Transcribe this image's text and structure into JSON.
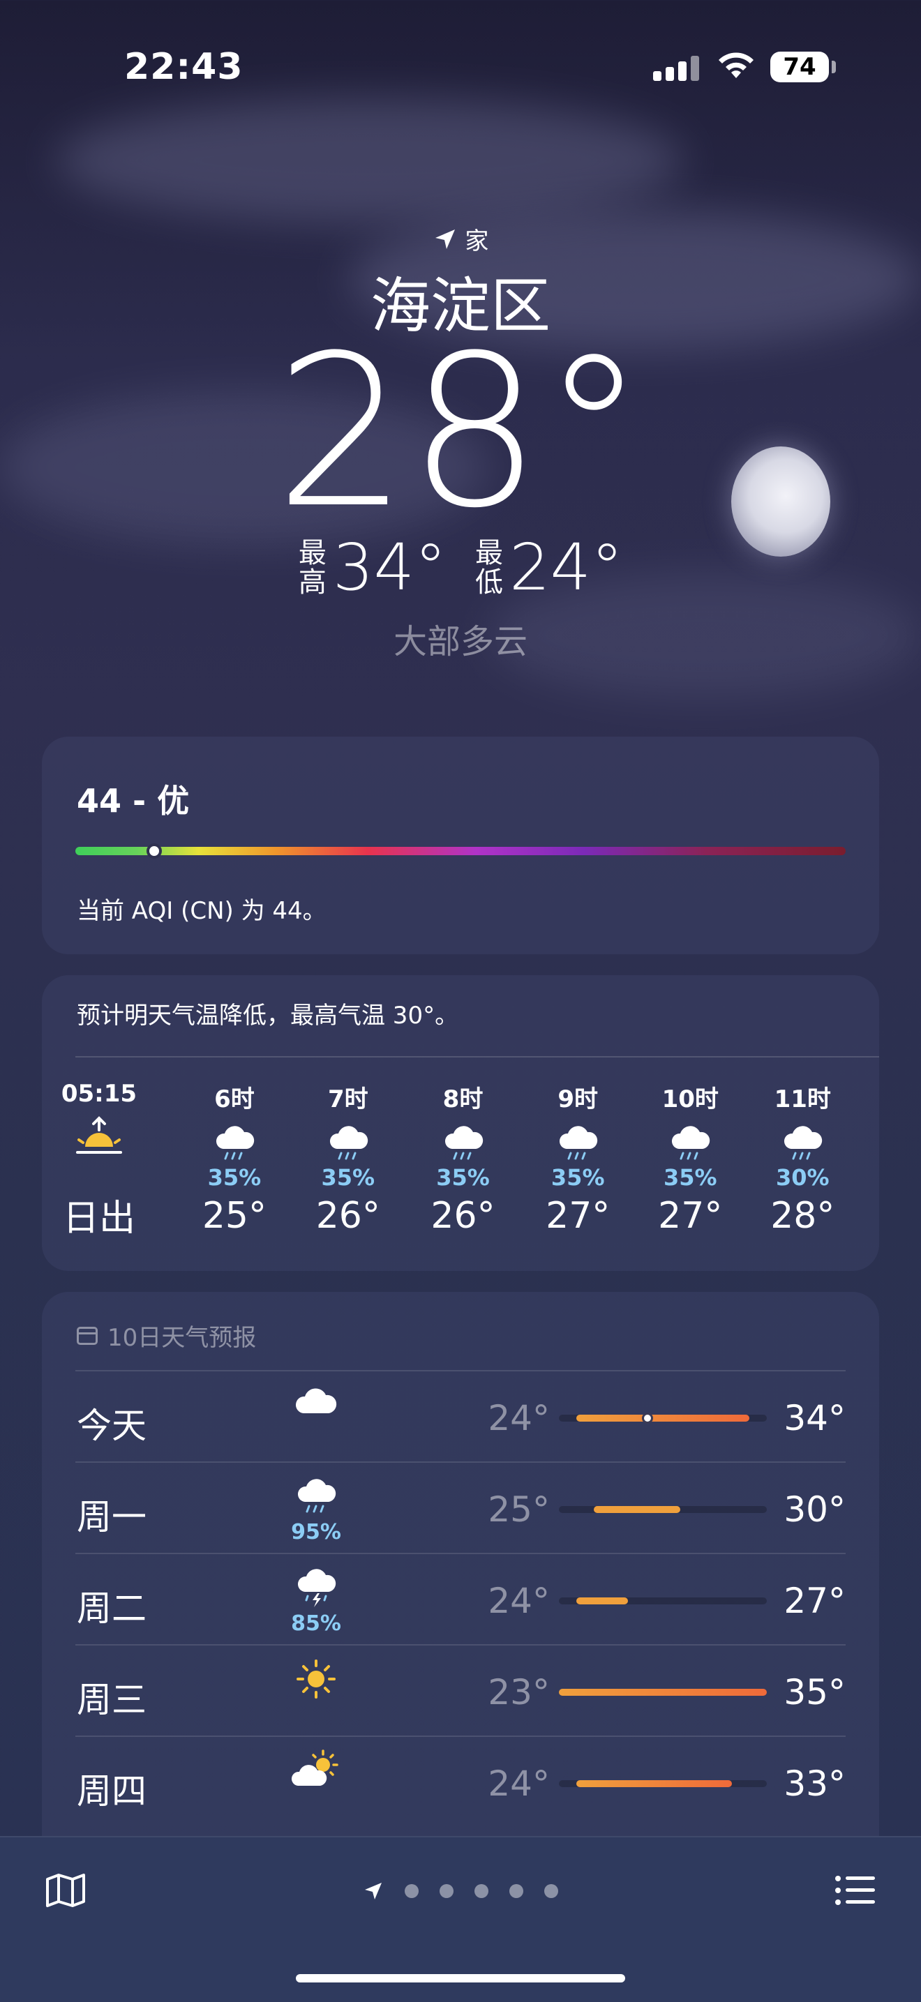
{
  "status_bar": {
    "time": "22:43",
    "battery": "74"
  },
  "location": {
    "label": "家",
    "city": "海淀区"
  },
  "current": {
    "temp": "28°",
    "high_label": "最高",
    "high": "34°",
    "low_label": "最低",
    "low": "24°",
    "condition": "大部多云"
  },
  "aqi": {
    "title": "44 - 优",
    "value": 44,
    "description": "当前 AQI (CN) 为 44。"
  },
  "hourly": {
    "summary": "预计明天气温降低，最高气温 30°。",
    "items": [
      {
        "hour": "05:15",
        "icon": "sunrise-icon",
        "pct": "",
        "temp": "日出"
      },
      {
        "hour": "6时",
        "icon": "rain-cloud-icon",
        "pct": "35%",
        "temp": "25°"
      },
      {
        "hour": "7时",
        "icon": "rain-cloud-icon",
        "pct": "35%",
        "temp": "26°"
      },
      {
        "hour": "8时",
        "icon": "rain-cloud-icon",
        "pct": "35%",
        "temp": "26°"
      },
      {
        "hour": "9时",
        "icon": "rain-cloud-icon",
        "pct": "35%",
        "temp": "27°"
      },
      {
        "hour": "10时",
        "icon": "rain-cloud-icon",
        "pct": "35%",
        "temp": "27°"
      },
      {
        "hour": "11时",
        "icon": "rain-cloud-icon",
        "pct": "30%",
        "temp": "28°"
      }
    ]
  },
  "daily": {
    "title": "10日天气预报",
    "days": [
      {
        "name": "今天",
        "icon": "cloud-icon",
        "rain": "",
        "low": "24°",
        "high": "34°"
      },
      {
        "name": "周一",
        "icon": "rain-cloud-icon",
        "rain": "95%",
        "low": "25°",
        "high": "30°"
      },
      {
        "name": "周二",
        "icon": "thunderstorm-icon",
        "rain": "85%",
        "low": "24°",
        "high": "27°"
      },
      {
        "name": "周三",
        "icon": "sun-icon",
        "rain": "",
        "low": "23°",
        "high": "35°"
      },
      {
        "name": "周四",
        "icon": "partly-sunny-icon",
        "rain": "",
        "low": "24°",
        "high": "33°"
      }
    ]
  },
  "colors": {
    "rain_pct": "#8ccdf5",
    "range_warm": "#f0a03c",
    "range_hot": "#ef6a3a",
    "background": "#2c2c4d"
  }
}
